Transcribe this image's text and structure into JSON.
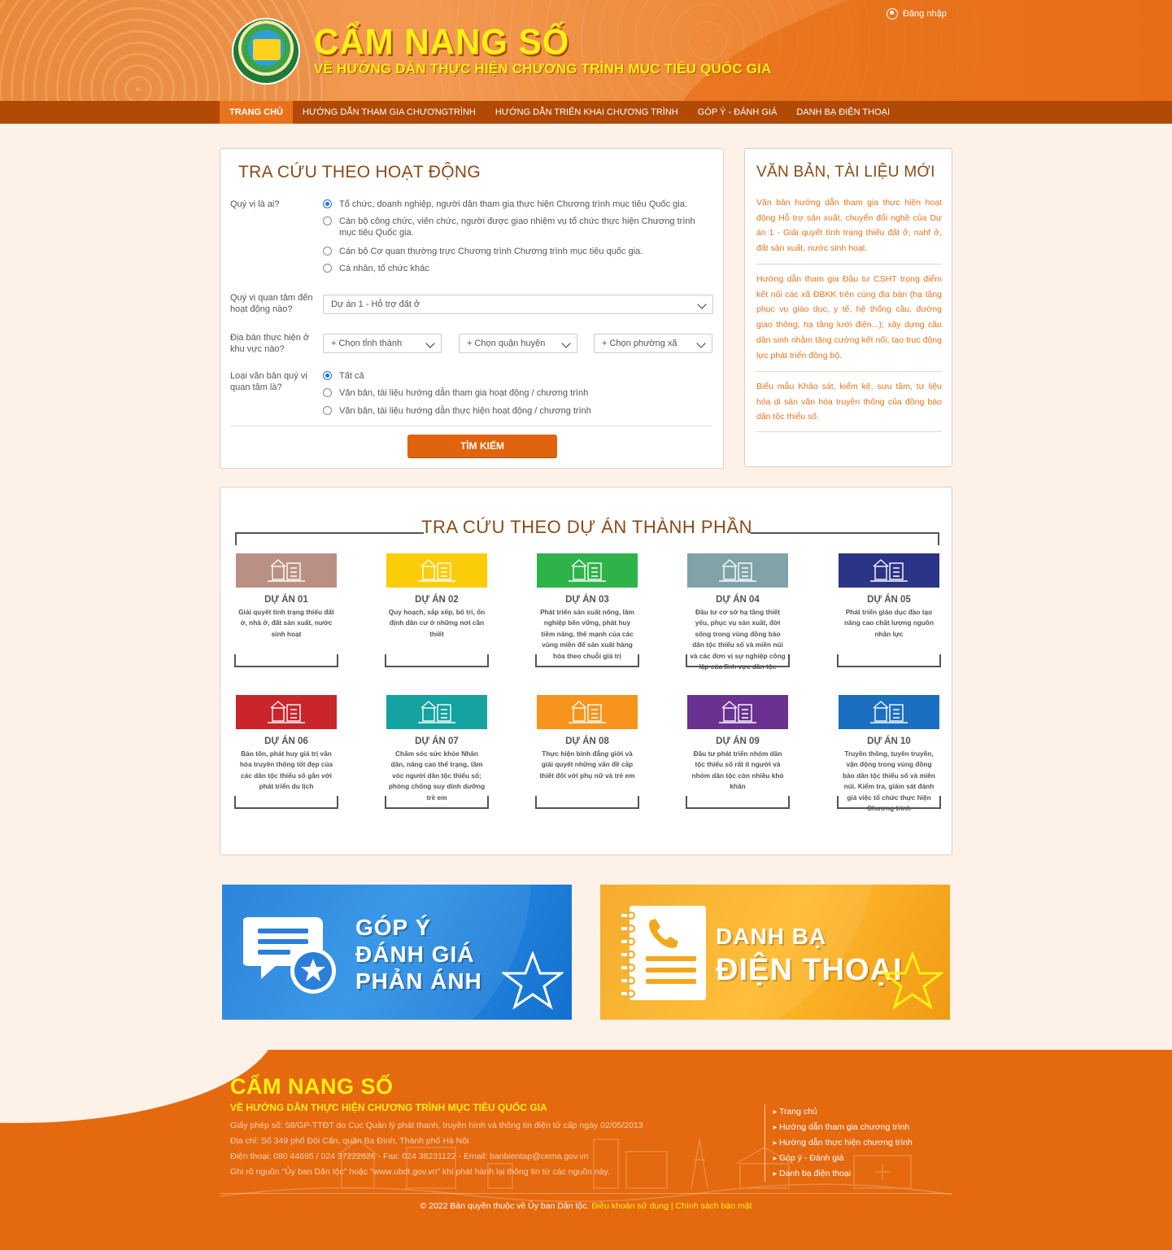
{
  "header": {
    "title": "CẨM NANG SỐ",
    "subtitle": "VỀ HƯỚNG DẪN THỰC HIỆN CHƯƠNG TRÌNH MỤC TIÊU QUỐC GIA",
    "login": "Đăng nhập",
    "logo_text": "Ủy ban Dân tộc"
  },
  "nav": {
    "items": [
      "TRANG CHỦ",
      "HƯỚNG DẪN THAM GIA CHƯƠNGTRÌNH",
      "HƯỚNG DẪN TRIỂN KHAI CHƯƠNG TRÌNH",
      "GÓP Ý - ĐÁNH GIÁ",
      "DANH BẠ ĐIỆN THOẠI"
    ]
  },
  "search": {
    "title": "TRA CỨU THEO HOẠT ĐỘNG",
    "who_label": "Quý vị là ai?",
    "who_options": [
      "Tổ chức, doanh nghiệp, người dân tham gia thực hiện Chương trình mục tiêu Quốc gia.",
      "Cán bộ công chức, viên chức, người được giao nhiệm vụ tổ chức thực hiện Chương trình mục tiêu Quốc gia.",
      "Cán bộ Cơ quan thường trực Chương trình Chương trình mục tiêu quốc gia.",
      "Cá nhân, tổ chức khác"
    ],
    "activity_label": "Quý vị quan tâm đến hoạt động nào?",
    "activity_value": "Dự án 1 - Hỗ trợ đất ở",
    "area_label": "Địa bàn thực hiện ở khu vực nào?",
    "province": "+ Chọn tỉnh thành",
    "district": "+ Chọn quận huyện",
    "ward": "+ Chọn phường xã",
    "doc_label": "Loại văn bản quý vị quan tâm là?",
    "doc_options": [
      "Tất cả",
      "Văn bản, tài liệu hướng dẫn tham gia hoạt động / chương trình",
      "Văn bản, tài liệu hướng dẫn thực hiện hoạt động / chương trình"
    ],
    "button": "TÌM KIẾM"
  },
  "news": {
    "title": "VĂN BẢN, TÀI LIỆU MỚI",
    "items": [
      "Văn bản hướng dẫn tham gia thực hiện hoạt động Hỗ trợ sản xuất, chuyển đổi nghề của Dự án 1 - Giải quyết tình trạng thiếu đất ở, nahf ở, đất sản xuất, nước sinh hoạt.",
      "Hướng dẫn tham gia Đầu tư CSHT trọng điểm kết nối các xã ĐBKK trên cùng địa bàn (hạ tầng phục vụ giáo dục, y tế, hệ thống cầu, đường giao thông; hạ tầng lưới điện...); xây dựng cầu dân sinh nhằm tăng cường kết nối, tạo trục động lực phát triển đồng bộ.",
      "Biểu mẫu Khảo sát, kiểm kê, sưu tầm, tư liệu hóa di sản văn hóa truyền thống của đồng bào dân tộc thiểu số."
    ]
  },
  "projects": {
    "title": "TRA CỨU THEO DỰ ÁN THÀNH PHẦN",
    "items": [
      {
        "name": "DỰ ÁN 01",
        "desc": "Giải quyết tình trạng thiếu đất ở, nhà ở, đất sản xuất, nước sinh hoạt",
        "color": "#b99083",
        "icon": "houses-icon"
      },
      {
        "name": "DỰ ÁN 02",
        "desc": "Quy hoạch, sắp xếp, bố trí, ổn định dân cư ở những nơi cần thiết",
        "color": "#fbcd09",
        "icon": "village-icon"
      },
      {
        "name": "DỰ ÁN 03",
        "desc": "Phát triển sản xuất nông, lâm nghiệp bền vững, phát huy tiềm năng, thế mạnh của các vùng miền để sản xuất hàng hóa theo chuỗi giá trị",
        "color": "#2eb24a",
        "icon": "forest-icon"
      },
      {
        "name": "DỰ ÁN 04",
        "desc": "Đầu tư cơ sở hạ tầng thiết yếu, phục vụ sản xuất, đời sống trong vùng đồng bào dân tộc thiểu số và miền núi và các đơn vị sự nghiệp công lập của lĩnh vực dân tộc",
        "color": "#7fa3a8",
        "icon": "infrastructure-icon"
      },
      {
        "name": "DỰ ÁN 05",
        "desc": "Phát triển giáo dục đào tạo nâng cao chất lượng nguồn nhân lực",
        "color": "#2b3486",
        "icon": "education-icon"
      },
      {
        "name": "DỰ ÁN 06",
        "desc": "Bảo tồn, phát huy giá trị văn hóa truyền thống tốt đẹp của các dân tộc thiểu số gắn với phát triển du lịch",
        "color": "#c9252b",
        "icon": "culture-icon"
      },
      {
        "name": "DỰ ÁN 07",
        "desc": "Chăm sóc sức khỏe Nhân dân, nâng cao thể trạng, tầm vóc người dân tộc thiểu số; phòng chống suy dinh dưỡng trẻ em",
        "color": "#14a3a0",
        "icon": "health-icon"
      },
      {
        "name": "DỰ ÁN 08",
        "desc": "Thực hiện bình đẳng giới và giải quyết những vấn đề cấp thiết đối với phụ nữ và trẻ em",
        "color": "#f7941d",
        "icon": "equality-icon"
      },
      {
        "name": "DỰ ÁN 09",
        "desc": "Đầu tư phát triển nhóm dân tộc thiểu số rất ít người và nhóm dân tộc còn nhiều khó khăn",
        "color": "#6a3191",
        "icon": "community-icon"
      },
      {
        "name": "DỰ ÁN 10",
        "desc": "Truyền thông, tuyên truyền, vận động trong vùng đồng bào dân tộc thiểu số và miền núi. Kiểm tra, giám sát đánh giá việc tổ chức thực hiện Chương trình",
        "color": "#1b6fc0",
        "icon": "media-icon"
      }
    ]
  },
  "banners": {
    "feedback": [
      "GÓP Ý",
      "ĐÁNH GIÁ",
      "PHẢN ÁNH"
    ],
    "phonebook_line1": "DANH BẠ",
    "phonebook_line2": "ĐIỆN THOẠI"
  },
  "footer": {
    "title": "CẨM NANG SỐ",
    "subtitle": "VỀ HƯỚNG DẪN THỰC HIỆN CHƯƠNG TRÌNH MỤC TIÊU QUỐC GIA",
    "lines": [
      "Giấy phép số: 58/GP-TTĐT do Cục Quản lý phát thanh, truyền hình và thông tin điện tử cấp ngày 02/05/2013",
      "Địa chỉ: Số 349 phố Đội Cấn, quận Ba Đình, Thành phố Hà Nội",
      "Điện thoại: 080 44695 / 024 37222626 - Fax: 024 38231122 - Email: banbientap@cema.gov.vn",
      "Ghi rõ nguồn \"Ủy ban Dân tộc\" hoặc \"www.ubdt.gov.vn\" khi phát hành lại thông tin từ các nguồn này."
    ],
    "links": [
      "Trang chủ",
      "Hướng dẫn tham gia chương trình",
      "Hướng dẫn thực hiện chương trình",
      "Góp ý - Đánh giá",
      "Danh bạ điện thoại"
    ],
    "copyright": "© 2022 Bản quyền thuộc về Ủy ban Dân tộc.",
    "terms": "Điều khoản sử dụng",
    "sep": "|",
    "privacy": "Chính sách bảo mật"
  }
}
